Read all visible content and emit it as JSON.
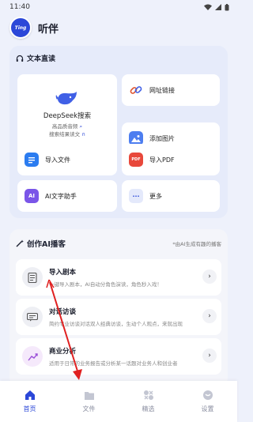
{
  "status": {
    "time": "11:40"
  },
  "header": {
    "logo_text": "Ting",
    "title": "听伴"
  },
  "text_read": {
    "title": "文本直读",
    "deepseek": {
      "label": "DeepSeek搜索",
      "line1": "高品质音频",
      "line2": "搜索结果读文"
    },
    "items": [
      {
        "label": "网址链接",
        "icon": "link-icon"
      },
      {
        "label": "添加图片",
        "icon": "image-icon"
      },
      {
        "label": "导入文件",
        "icon": "file-icon"
      },
      {
        "label": "导入PDF",
        "icon": "pdf-icon",
        "icon_text": "PDF"
      },
      {
        "label": "AI文字助手",
        "icon": "ai-icon",
        "icon_text": "AI"
      },
      {
        "label": "更多",
        "icon": "more-icon",
        "icon_text": "···"
      }
    ]
  },
  "create": {
    "title": "创作AI播客",
    "note": "*由AI生成有趣的播客",
    "features": [
      {
        "title": "导入剧本",
        "desc": "一键导入剧本，AI自动分角色演读，角色秒入戏！"
      },
      {
        "title": "对话访谈",
        "desc": "简约专业访谈对话双人经典访谈，生动个人观点，来就出现"
      },
      {
        "title": "商业分析",
        "desc": "适用于日常的业务报告或分析某一话题对业务人和创业者"
      }
    ],
    "arrow": "›"
  },
  "nav": [
    {
      "label": "首页",
      "icon": "home-icon"
    },
    {
      "label": "文件",
      "icon": "folder-icon"
    },
    {
      "label": "精选",
      "icon": "featured-icon"
    },
    {
      "label": "设置",
      "icon": "settings-icon"
    }
  ],
  "colors": {
    "primary": "#2b47d8",
    "panel": "#e6ebfa",
    "annotation": "#e02020"
  }
}
